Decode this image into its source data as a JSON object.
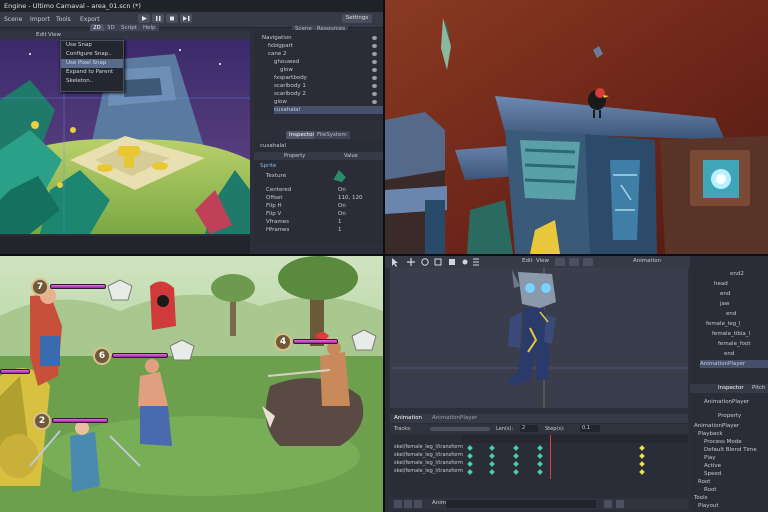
{
  "editor": {
    "window_title": "Engine - Ultimo Carnaval - area_01.scn (*)",
    "menu": [
      "Scene",
      "Import",
      "Tools",
      "Export"
    ],
    "workspace_tabs": [
      "2D",
      "3D",
      "Script",
      "Help"
    ],
    "settings_label": "Settings",
    "dock_tabs": [
      "Scene",
      "Resources"
    ],
    "scene_tree": [
      "Navigation",
      "fxbigpart",
      "cane 2",
      "ghouwed",
      "glow",
      "fxspartbody",
      "scarlbody 1",
      "scarlbody 2",
      "glow",
      "cusahalal"
    ],
    "inspector_tabs": [
      "Inspector",
      "FileSystem"
    ],
    "inspector_node": "cusahalal",
    "inspector_headers": [
      "Property",
      "Value"
    ],
    "inspector_section": "Sprite",
    "inspector_rows": [
      {
        "name": "Texture",
        "value": ""
      },
      {
        "name": "Centered",
        "value": "On"
      },
      {
        "name": "Offset",
        "value": "110, 120"
      },
      {
        "name": "Flip H",
        "value": "On"
      },
      {
        "name": "Flip V",
        "value": "On"
      },
      {
        "name": "Vframes",
        "value": "1"
      },
      {
        "name": "Hframes",
        "value": "1"
      }
    ],
    "edit_menu": [
      "Edit",
      "View"
    ],
    "context_menu": [
      "Use Snap",
      "Configure Snap..",
      "Use Pixel Snap",
      "Expand to Parent",
      "Skeleton.."
    ]
  },
  "battle": {
    "units": [
      {
        "level": "7",
        "hp": 1.0
      },
      {
        "level": "6",
        "hp": 1.0
      },
      {
        "level": "2",
        "hp": 1.0
      },
      {
        "level": "4",
        "hp": 0.8
      }
    ]
  },
  "animation": {
    "toolbar": [
      "Edit",
      "View"
    ],
    "toolbar_right": "Animation",
    "bone_tree": [
      "end2",
      "head",
      "end",
      "jaw",
      "end",
      "female_leg_l",
      "female_tibia_l",
      "female_foot",
      "end"
    ],
    "node_type": "AnimationPlayer",
    "side_tabs": [
      "Inspector",
      "Pitch"
    ],
    "side_node": "AnimationPlayer",
    "side_header": "Property",
    "side_props": [
      "AnimationPlayer",
      "Playback",
      "Process Mode",
      "Default Blend Time",
      "Play",
      "Active",
      "Speed",
      "Root",
      "Root",
      "Tools",
      "Playout"
    ],
    "panel_tabs": [
      "Animation",
      "AnimationPlayer"
    ],
    "track_toolbar": [
      "Tracks:",
      "Len(s):",
      "2",
      "Step(s):",
      "0.1"
    ],
    "tracks": [
      "skel/female_leg_l/transform",
      "skel/female_leg_l/transform",
      "skel/female_leg_l/transform",
      "skel/female_leg_l/transform"
    ],
    "bottom_label": "Anim"
  },
  "colors": {
    "accent": "#5a6a8a",
    "keyframe_green": "#4ad0b0",
    "keyframe_yellow": "#e8e048",
    "playhead": "#d94040"
  }
}
